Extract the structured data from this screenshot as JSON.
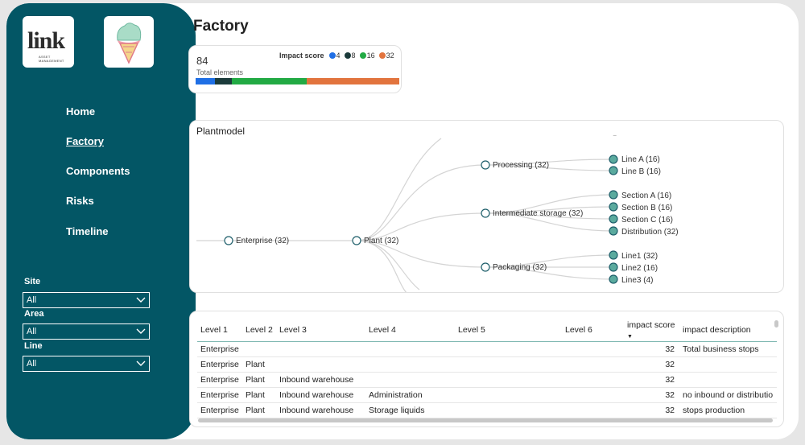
{
  "nav": {
    "items": [
      {
        "label": "Home"
      },
      {
        "label": "Factory"
      },
      {
        "label": "Components"
      },
      {
        "label": "Risks"
      },
      {
        "label": "Timeline"
      }
    ]
  },
  "logo": {
    "text": "link",
    "subtitle": "ASSET MANAGEMENT"
  },
  "slicers": [
    {
      "label": "Site",
      "value": "All"
    },
    {
      "label": "Area",
      "value": "All"
    },
    {
      "label": "Line",
      "value": "All"
    }
  ],
  "page": {
    "title": "Factory"
  },
  "kpi": {
    "value": "84",
    "caption": "Total elements",
    "legend_title": "Impact score",
    "legend": [
      {
        "label": "4",
        "color": "#1f6fe5",
        "share": 0.095
      },
      {
        "label": "8",
        "color": "#1b3b3b",
        "share": 0.083
      },
      {
        "label": "16",
        "color": "#22aa44",
        "share": 0.369
      },
      {
        "label": "32",
        "color": "#e2743e",
        "share": 0.453
      }
    ]
  },
  "tree": {
    "title": "Plantmodel",
    "nodes": {
      "enterprise": "Enterprise (32)",
      "plant": "Plant (32)",
      "processing": "Processing (32)",
      "intermediate": "Intermediate storage (32)",
      "packaging": "Packaging (32)",
      "lineA": "Line A (16)",
      "lineB": "Line B (16)",
      "sectionA": "Section A (16)",
      "sectionB": "Section B (16)",
      "sectionC": "Section C (16)",
      "distribution": "Distribution (32)",
      "line1": "Line1 (32)",
      "line2": "Line2 (16)",
      "line3": "Line3 (4)"
    }
  },
  "table": {
    "columns": [
      "Level 1",
      "Level 2",
      "Level 3",
      "Level 4",
      "Level 5",
      "Level 6",
      "impact score",
      "impact description"
    ],
    "rows": [
      [
        "Enterprise",
        "",
        "",
        "",
        "",
        "",
        "32",
        "Total business stops"
      ],
      [
        "Enterprise",
        "Plant",
        "",
        "",
        "",
        "",
        "32",
        ""
      ],
      [
        "Enterprise",
        "Plant",
        "Inbound warehouse",
        "",
        "",
        "",
        "32",
        ""
      ],
      [
        "Enterprise",
        "Plant",
        "Inbound warehouse",
        "Administration",
        "",
        "",
        "32",
        "no inbound or distributio"
      ],
      [
        "Enterprise",
        "Plant",
        "Inbound warehouse",
        "Storage liquids",
        "",
        "",
        "32",
        "stops production"
      ]
    ]
  }
}
